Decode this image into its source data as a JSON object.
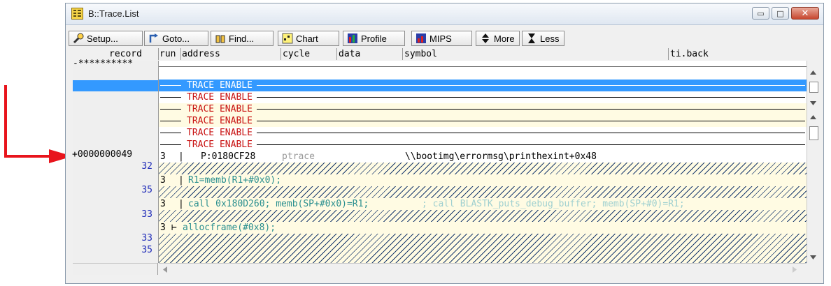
{
  "window": {
    "title": "B::Trace.List",
    "minimize_glyph": "▭",
    "maximize_glyph": "□",
    "close_glyph": "✕"
  },
  "toolbar": {
    "setup": "Setup...",
    "goto": "Goto...",
    "find": "Find...",
    "chart": "Chart",
    "profile": "Profile",
    "mips": "MIPS",
    "more": "More",
    "less": "Less"
  },
  "columns": {
    "record": "record",
    "run": "run",
    "address": "address",
    "cycle": "cycle",
    "data": "data",
    "symbol": "symbol",
    "tiback": "ti.back"
  },
  "record_header_value": "-**********",
  "trace_enable_text": "TRACE ENABLE",
  "trace_row": {
    "record": "+0000000049",
    "run": "3",
    "address": "P:0180CF28",
    "cycle": "ptrace",
    "symbol": "\\\\bootimg\\errormsg\\printhexint+0x48"
  },
  "line_numbers": [
    "32",
    "35",
    "33",
    "33",
    "35"
  ],
  "code_lines": [
    {
      "run": "3",
      "marker": "|",
      "code": "R1=memb(R1+#0x0);",
      "comment": ""
    },
    {
      "run": "3",
      "marker": "|",
      "code": "call 0x180D260; memb(SP+#0x0)=R1;",
      "comment": "; call BLASTK_puts_debug_buffer; memb(SP+#0)=R1;"
    },
    {
      "run": "3",
      "marker": "⊢",
      "code": "allocframe(#0x8);",
      "comment": ""
    }
  ],
  "colors": {
    "selection": "#3399ff",
    "trace_enable": "#c81010",
    "line_number": "#1f2bb8",
    "code": "#2a8f8f",
    "arrow": "#e8141c"
  }
}
